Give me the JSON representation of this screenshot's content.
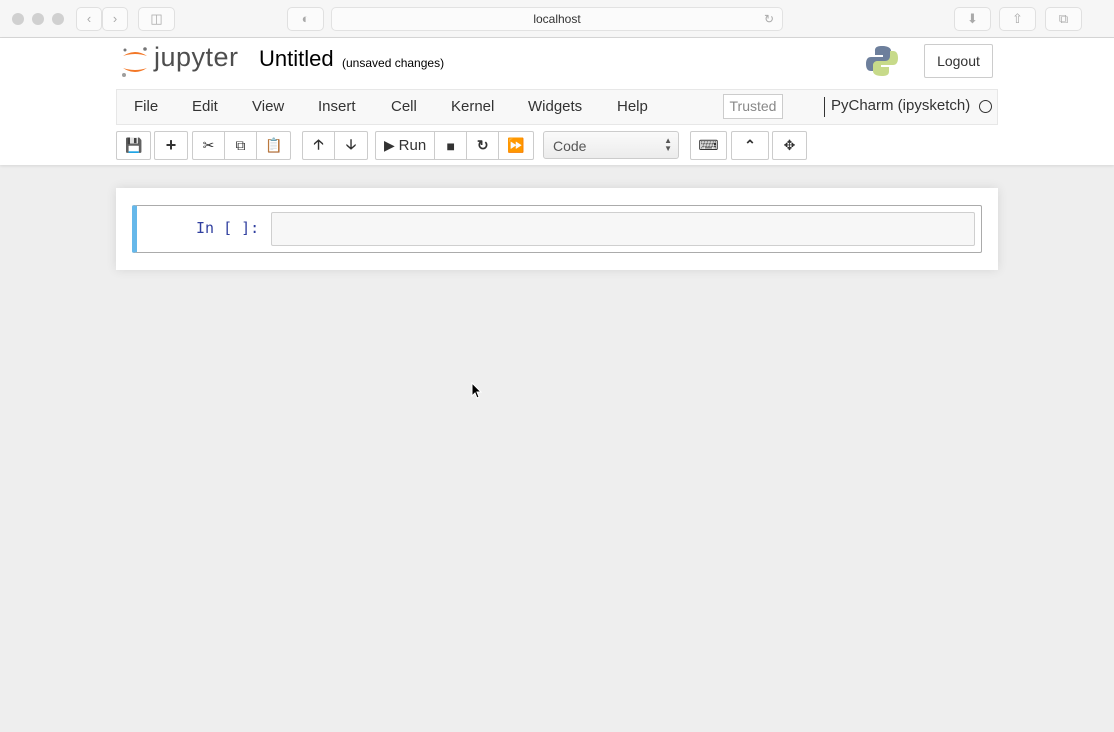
{
  "browser": {
    "url": "localhost"
  },
  "header": {
    "logo_text": "jupyter",
    "title": "Untitled",
    "save_status": "(unsaved changes)",
    "logout": "Logout"
  },
  "menu": {
    "items": [
      "File",
      "Edit",
      "View",
      "Insert",
      "Cell",
      "Kernel",
      "Widgets",
      "Help"
    ],
    "trusted": "Trusted",
    "kernel_name": "PyCharm (ipysketch)"
  },
  "toolbar": {
    "run": "Run",
    "cell_type": "Code"
  },
  "cell": {
    "prompt": "In [ ]:",
    "source": ""
  },
  "colors": {
    "accent": "#66b8ea",
    "logo_orange": "#f37726"
  }
}
